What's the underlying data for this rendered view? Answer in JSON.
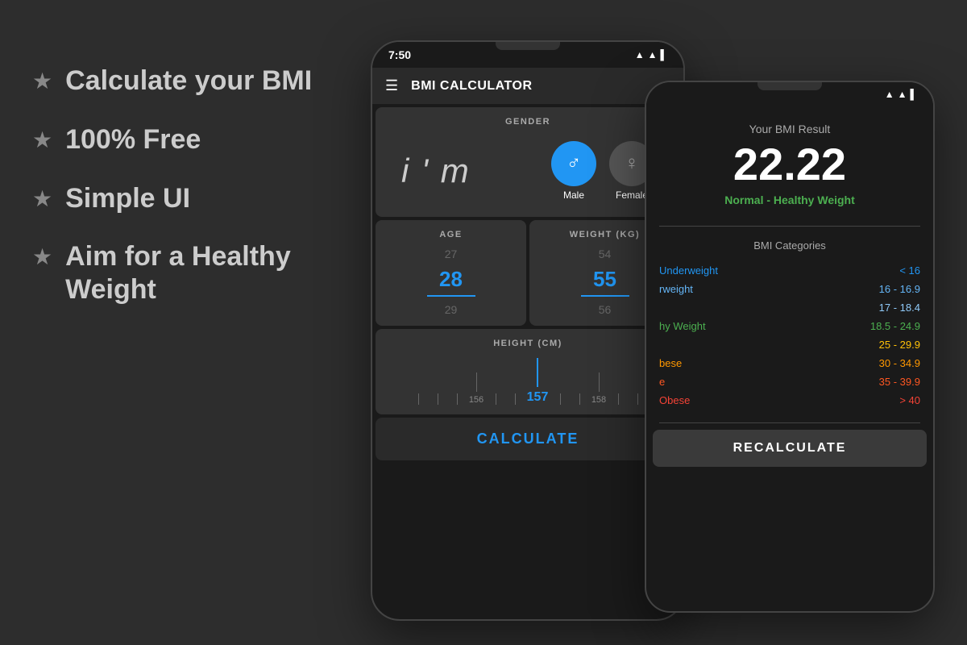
{
  "page": {
    "background": "#2d2d2d"
  },
  "left_panel": {
    "features": [
      {
        "id": "feature-bmi",
        "text": "Calculate your BMI"
      },
      {
        "id": "feature-free",
        "text": "100% Free"
      },
      {
        "id": "feature-ui",
        "text": "Simple UI"
      },
      {
        "id": "feature-healthy",
        "text": "Aim for a Healthy Weight"
      }
    ],
    "star_symbol": "★"
  },
  "phone_primary": {
    "status_bar": {
      "time": "7:50",
      "icons": "▲ ▌▌"
    },
    "app_bar": {
      "menu_icon": "☰",
      "title": "BMI CALCULATOR"
    },
    "gender_section": {
      "label": "GENDER",
      "im_text": "i ' m",
      "male_symbol": "♂",
      "female_symbol": "♀",
      "male_label": "Male",
      "female_label": "Female"
    },
    "age_section": {
      "label": "AGE",
      "prev_value": "27",
      "current_value": "28",
      "next_value": "29"
    },
    "weight_section": {
      "label": "WEIGHT (KG)",
      "prev_value": "54",
      "current_value": "55",
      "next_value": "56"
    },
    "height_section": {
      "label": "HEIGHT (CM)",
      "ruler_values": [
        "156",
        "157",
        "158"
      ],
      "current_height": "157"
    },
    "calculate_button": {
      "label": "CALCULATE"
    }
  },
  "phone_secondary": {
    "status_bar": {
      "icons": "▲ ▌▌"
    },
    "result_section": {
      "title": "Your BMI Result",
      "value": "22.22",
      "status": "Normal - Healthy Weight"
    },
    "categories_section": {
      "title": "BMI Categories",
      "categories": [
        {
          "name": "Underweight",
          "range": "< 16",
          "color": "#2196F3"
        },
        {
          "name": "Underweight",
          "range": "16 - 16.9",
          "color": "#2196F3"
        },
        {
          "name": "",
          "range": "17 - 18.4",
          "color": "#64B5F6"
        },
        {
          "name": "Healthy Weight",
          "range": "18.5 - 24.9",
          "color": "#4CAF50"
        },
        {
          "name": "",
          "range": "25 - 29.9",
          "color": "#FFC107"
        },
        {
          "name": "Obese",
          "range": "30 - 34.9",
          "color": "#FF9800"
        },
        {
          "name": "e",
          "range": "35 - 39.9",
          "color": "#FF5722"
        },
        {
          "name": "Obese",
          "range": "> 40",
          "color": "#F44336"
        }
      ]
    },
    "recalculate_button": {
      "label": "RECALCULATE"
    }
  }
}
